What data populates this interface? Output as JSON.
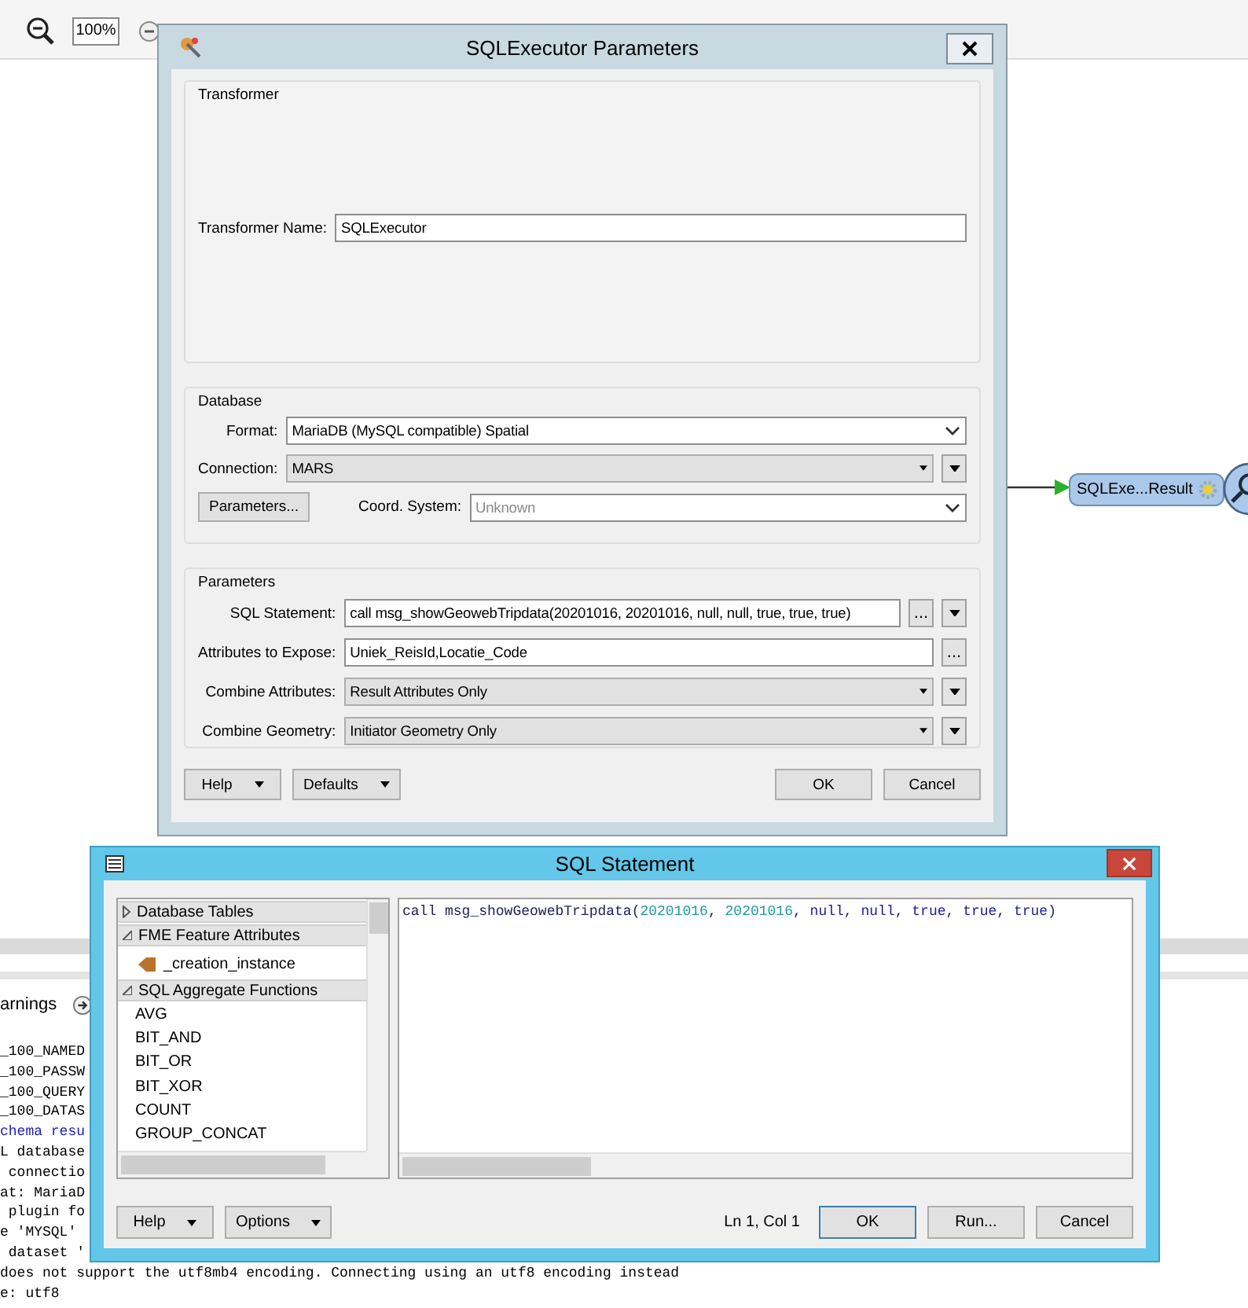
{
  "toolbar": {
    "zoom_field": "100%"
  },
  "canvas": {
    "nodes": [
      {
        "label": "SQLExe...Result"
      }
    ]
  },
  "log_panel": {
    "tab": "arnings",
    "lines": [
      {
        "text": "_100_NAMED",
        "color": "#000000"
      },
      {
        "text": "_100_PASSW",
        "color": "#000000"
      },
      {
        "text": "_100_QUERY",
        "color": "#000000"
      },
      {
        "text": "_100_DATAS",
        "color": "#000000"
      },
      {
        "text": "chema resu",
        "color": "#1a1ac8"
      },
      {
        "text": "L database",
        "color": "#000000"
      },
      {
        "text": " connectio",
        "color": "#000000"
      },
      {
        "text": "at: MariaD",
        "color": "#000000"
      },
      {
        "text": " plugin fo",
        "color": "#000000"
      },
      {
        "text": "e 'MYSQL'",
        "color": "#000000"
      },
      {
        "text": " dataset '",
        "color": "#000000"
      },
      {
        "text": "does not support the utf8mb4 encoding. Connecting using an utf8 encoding instead",
        "color": "#000000"
      },
      {
        "text": "e: utf8",
        "color": "#000000"
      }
    ]
  },
  "parameters_dialog": {
    "title": "SQLExecutor Parameters",
    "transformer": {
      "title": "Transformer",
      "name_label": "Transformer Name:",
      "name_value": "SQLExecutor"
    },
    "database": {
      "title": "Database",
      "fields": [
        {
          "label": "Format:",
          "kind": "chevron",
          "value": "MariaDB (MySQL compatible) Spatial",
          "menu": false
        },
        {
          "label": "Connection:",
          "kind": "dropdown",
          "value": "MARS",
          "menu": true
        }
      ],
      "parameters_button": "Parameters...",
      "coord": {
        "label": "Coord. System:",
        "value": "Unknown",
        "disabled": true
      }
    },
    "parameters": {
      "title": "Parameters",
      "fields": [
        {
          "label": "SQL Statement:",
          "kind": "input",
          "value": "call msg_showGeowebTripdata(20201016, 20201016, null, null, true, true, true)",
          "browse": "...",
          "menu": true
        },
        {
          "label": "Attributes to Expose:",
          "kind": "input",
          "value": "Uniek_ReisId,Locatie_Code",
          "browse": "...",
          "menu": false
        },
        {
          "label": "Combine Attributes:",
          "kind": "dropdown",
          "value": "Result Attributes Only",
          "menu": true
        },
        {
          "label": "Combine Geometry:",
          "kind": "dropdown",
          "value": "Initiator Geometry Only",
          "menu": true
        }
      ]
    },
    "buttons_left": [
      {
        "label": "Help",
        "split": true
      },
      {
        "label": "Defaults",
        "split": true
      }
    ],
    "buttons_right": [
      {
        "label": "OK",
        "default": false
      },
      {
        "label": "Cancel",
        "default": false
      }
    ]
  },
  "sql_dialog": {
    "title": "SQL Statement",
    "tree": [
      {
        "label": "Database Tables",
        "expanded": false
      },
      {
        "label": "FME Feature Attributes",
        "expanded": true,
        "children": [
          {
            "label": "_creation_instance",
            "kind": "attribute"
          }
        ]
      },
      {
        "label": "SQL Aggregate Functions",
        "expanded": true,
        "children": [
          {
            "label": "AVG",
            "kind": "function"
          },
          {
            "label": "BIT_AND",
            "kind": "function"
          },
          {
            "label": "BIT_OR",
            "kind": "function"
          },
          {
            "label": "BIT_XOR",
            "kind": "function"
          },
          {
            "label": "COUNT",
            "kind": "function"
          },
          {
            "label": "GROUP_CONCAT",
            "kind": "function"
          }
        ]
      }
    ],
    "code": [
      {
        "kind": "plain",
        "text": "call msg_showGeowebTripdata("
      },
      {
        "kind": "number",
        "text": "20201016"
      },
      {
        "kind": "plain",
        "text": ", "
      },
      {
        "kind": "number",
        "text": "20201016"
      },
      {
        "kind": "plain",
        "text": ", "
      },
      {
        "kind": "keyword",
        "text": "null"
      },
      {
        "kind": "plain",
        "text": ", "
      },
      {
        "kind": "keyword",
        "text": "null"
      },
      {
        "kind": "plain",
        "text": ", "
      },
      {
        "kind": "keyword",
        "text": "true"
      },
      {
        "kind": "plain",
        "text": ", "
      },
      {
        "kind": "keyword",
        "text": "true"
      },
      {
        "kind": "plain",
        "text": ", "
      },
      {
        "kind": "keyword",
        "text": "true"
      },
      {
        "kind": "plain",
        "text": ")"
      }
    ],
    "cursor": "Ln 1, Col 1",
    "buttons_left": [
      {
        "label": "Help",
        "split": true
      },
      {
        "label": "Options",
        "split": true
      }
    ],
    "buttons_right": [
      {
        "label": "OK",
        "default": true
      },
      {
        "label": "Run...",
        "default": false
      },
      {
        "label": "Cancel",
        "default": false
      }
    ]
  }
}
